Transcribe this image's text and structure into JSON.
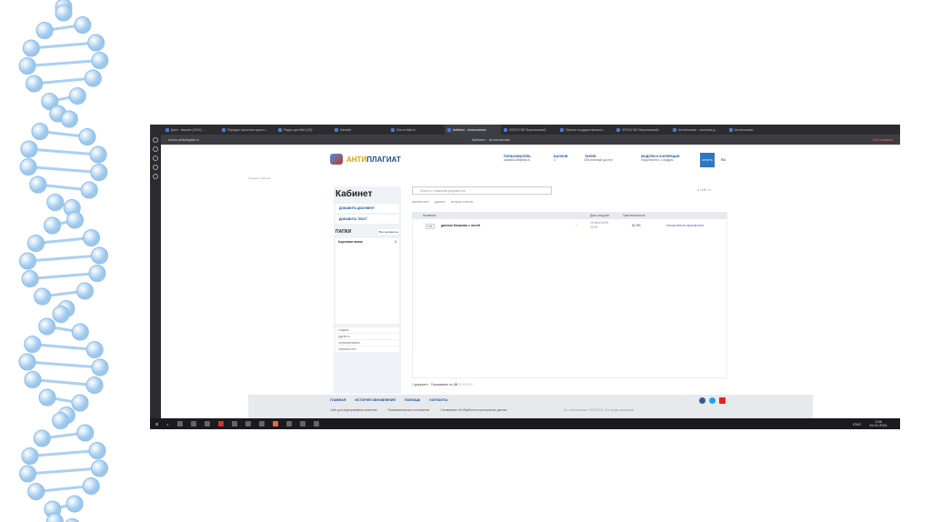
{
  "browser": {
    "tabs": [
      "Дзен - вернее (2019) ...",
      "Порядок изучения одного...",
      "Радио для ВМ (2/5)",
      "Kanalat",
      "Почта Mail.ru",
      "Кабинет - Антиплагиат",
      "ФГБОУ ВО Воронежский...",
      "Портал государственных...",
      "ФГБОУ ВО Воронежский...",
      "Антиплагиат - система д...",
      "Антиплагиат"
    ],
    "address": "users.antiplagiat.ru",
    "page_title": "Кабинет - Антиплагиат",
    "badge": "135 отзывов"
  },
  "header": {
    "logo_a": "АНТИ",
    "logo_b": "ПЛАГИАТ",
    "user_label": "ПОЛЬЗОВАТЕЛЬ",
    "user_email": "natasha158@list.ru",
    "points_label": "БАЛЛОВ",
    "points_value": "3",
    "tariff_label": "ТАРИФ",
    "tariff_value": "Бесплатный доступ",
    "modules_label": "МОДУЛИ И КОЛЛЕКЦИИ",
    "modules_value": "Подключено: 1 модуль",
    "buy_label": "КУПИТЬ",
    "lang": "RU"
  },
  "breadcrumb": "Главная / Кабинет",
  "sidebar": {
    "title": "Кабинет",
    "add_doc": "ДОБАВИТЬ ДОКУМЕНТ",
    "add_text": "ДОБАВИТЬ ТЕКСТ",
    "folders_title": "ПАПКИ",
    "all_docs": "Все документы",
    "folder_name": "Корневая папка",
    "folder_count": "1",
    "actions": [
      "создать",
      "удалить",
      "переименовать",
      "переместить"
    ]
  },
  "main": {
    "search_placeholder": "Поиск по названию документов",
    "page": "1/1",
    "actions": [
      "переместить",
      "удалить",
      "история отчетов"
    ],
    "columns": [
      "Название",
      "Дата загрузки",
      "Оригинальность"
    ],
    "rows": [
      {
        "type": "TXT",
        "name": "диплом Мешкова с литой",
        "date": "15 Июн 2019",
        "time": "22:00",
        "originality": "61,9%",
        "action": "ПОСМОТРЕТЬ РЕЗУЛЬТАТЫ"
      }
    ],
    "count": "1 документ",
    "show_by": "Показывать по",
    "per_page": [
      "10",
      "20",
      "50",
      "100"
    ]
  },
  "footer": {
    "links": [
      "ГЛАВНАЯ",
      "ИСТОРИЯ ОБНОВЛЕНИЙ",
      "ПОМОЩЬ",
      "КОНТАКТЫ"
    ],
    "links2": [
      "Сайт для корпоративных клиентов",
      "Пользовательское соглашение",
      "Соглашение об обработке персональных данных"
    ],
    "copyright": "АО «Антиплагиат» 2005-2021. Все права защищены"
  },
  "taskbar": {
    "lang": "ENG",
    "time": "1:56",
    "date": "19.01.2021"
  }
}
